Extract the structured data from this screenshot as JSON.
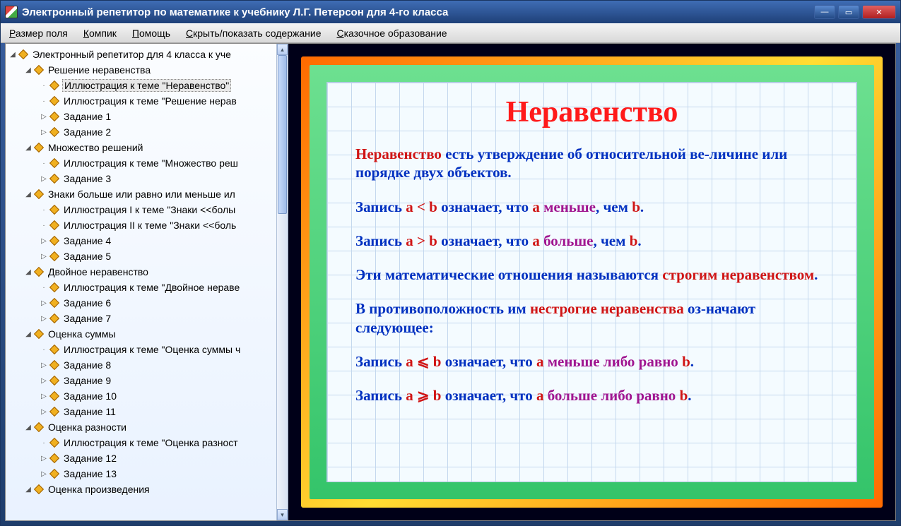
{
  "window": {
    "title": "Электронный репетитор по математике к учебнику Л.Г. Петерсон для 4-го класса"
  },
  "menu": {
    "items": [
      "Размер поля",
      "Компик",
      "Помощь",
      "Скрыть/показать содержание",
      "Сказочное образование"
    ],
    "accel": [
      "Р",
      "К",
      "П",
      "С",
      "С"
    ]
  },
  "tree": [
    {
      "level": 0,
      "expanded": true,
      "label": "Электронный репетитор для 4 класса к уче"
    },
    {
      "level": 1,
      "expanded": true,
      "label": "Решение неравенства"
    },
    {
      "level": 2,
      "leaf": true,
      "selected": true,
      "label": "Иллюстрация к теме \"Неравенство\""
    },
    {
      "level": 2,
      "leaf": true,
      "label": "Иллюстрация к теме \"Решение нерав"
    },
    {
      "level": 2,
      "expandable": true,
      "label": "Задание 1"
    },
    {
      "level": 2,
      "expandable": true,
      "label": "Задание 2"
    },
    {
      "level": 1,
      "expanded": true,
      "label": "Множество решений"
    },
    {
      "level": 2,
      "leaf": true,
      "label": "Иллюстрация к теме \"Множество реш"
    },
    {
      "level": 2,
      "expandable": true,
      "label": "Задание 3"
    },
    {
      "level": 1,
      "expanded": true,
      "label": "Знаки больше или равно или меньше ил"
    },
    {
      "level": 2,
      "leaf": true,
      "label": "Иллюстрация I к теме \"Знаки <<болы"
    },
    {
      "level": 2,
      "leaf": true,
      "label": "Иллюстрация II к теме \"Знаки <<боль"
    },
    {
      "level": 2,
      "expandable": true,
      "label": "Задание 4"
    },
    {
      "level": 2,
      "expandable": true,
      "label": "Задание 5"
    },
    {
      "level": 1,
      "expanded": true,
      "label": "Двойное неравенство"
    },
    {
      "level": 2,
      "leaf": true,
      "label": "Иллюстрация к теме \"Двойное нераве"
    },
    {
      "level": 2,
      "expandable": true,
      "label": "Задание 6"
    },
    {
      "level": 2,
      "expandable": true,
      "label": "Задание 7"
    },
    {
      "level": 1,
      "expanded": true,
      "label": "Оценка суммы"
    },
    {
      "level": 2,
      "leaf": true,
      "label": "Иллюстрация к теме \"Оценка суммы ч"
    },
    {
      "level": 2,
      "expandable": true,
      "label": "Задание 8"
    },
    {
      "level": 2,
      "expandable": true,
      "label": "Задание 9"
    },
    {
      "level": 2,
      "expandable": true,
      "label": "Задание 10"
    },
    {
      "level": 2,
      "expandable": true,
      "label": "Задание 11"
    },
    {
      "level": 1,
      "expanded": true,
      "label": "Оценка разности"
    },
    {
      "level": 2,
      "leaf": true,
      "label": "Иллюстрация к теме \"Оценка разност"
    },
    {
      "level": 2,
      "expandable": true,
      "label": "Задание 12"
    },
    {
      "level": 2,
      "expandable": true,
      "label": "Задание 13"
    },
    {
      "level": 1,
      "expanded": true,
      "label": "Оценка произведения"
    }
  ],
  "lesson": {
    "title": "Неравенство",
    "paras": [
      {
        "html": "<span class='red'>Неравенство</span> есть утверждение об относительной ве-личине или порядке двух объектов."
      },
      {
        "html": "Запись <span class='red'>а &lt; b</span> означает, что <span class='red'>а</span> <span class='mag'>меньше</span>, чем <span class='red'>b</span>."
      },
      {
        "html": "Запись <span class='red'>а &gt; b</span> означает, что <span class='red'>а</span> <span class='mag'>больше</span>, чем <span class='red'>b</span>."
      },
      {
        "html": "Эти математические отношения называются <span class='red'>строгим неравенством</span>."
      },
      {
        "html": "В противоположность им <span class='red'>нестрогие неравенства</span> оз-начают следующее:"
      },
      {
        "html": "Запись <span class='red'>а ⩽ b</span> означает, что <span class='red'>а</span> <span class='mag'>меньше либо равно</span> <span class='red'>b</span>."
      },
      {
        "html": "Запись <span class='red'>а ⩾ b</span> означает, что <span class='red'>а</span> <span class='mag'>больше либо равно</span> <span class='red'>b</span>."
      }
    ]
  }
}
